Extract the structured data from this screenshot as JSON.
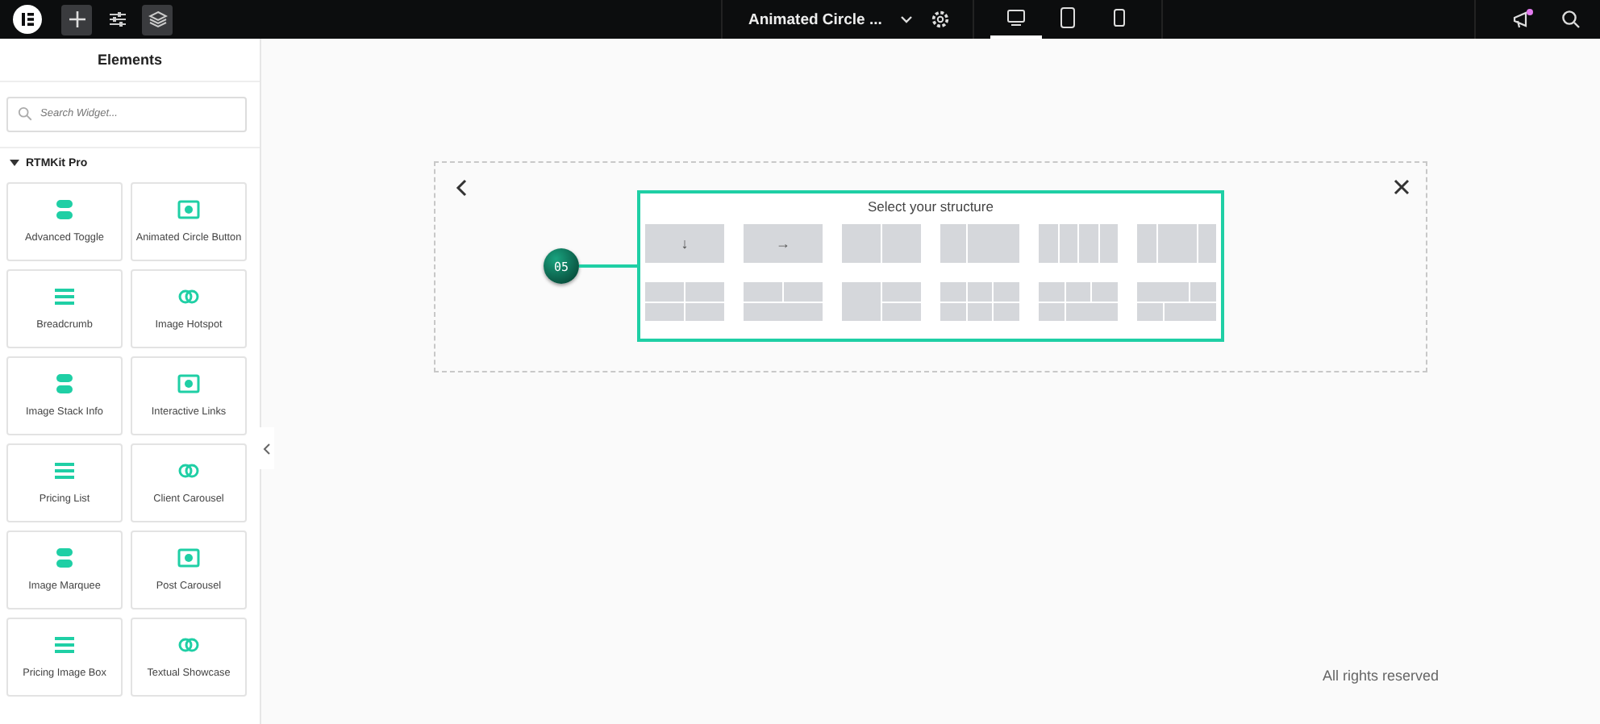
{
  "topbar": {
    "document_title": "Animated Circle ...",
    "devices": [
      {
        "selected": true
      },
      {
        "selected": false
      },
      {
        "selected": false
      }
    ],
    "notification": true
  },
  "sidebar": {
    "title": "Elements",
    "search": {
      "placeholder": "Search Widget..."
    },
    "category": {
      "label": "RTMKit Pro",
      "expanded": true
    },
    "widgets": [
      {
        "label": "Advanced Toggle"
      },
      {
        "label": "Animated Circle Button"
      },
      {
        "label": "Breadcrumb"
      },
      {
        "label": "Image Hotspot"
      },
      {
        "label": "Image Stack Info"
      },
      {
        "label": "Interactive Links"
      },
      {
        "label": "Pricing List"
      },
      {
        "label": "Client Carousel"
      },
      {
        "label": "Image Marquee"
      },
      {
        "label": "Post Carousel"
      },
      {
        "label": "Pricing Image Box"
      },
      {
        "label": "Textual Showcase"
      }
    ]
  },
  "canvas": {
    "step_badge": "05",
    "structure_picker": {
      "title": "Select your structure",
      "structures": [
        {
          "kind": "single",
          "glyph": "↓"
        },
        {
          "kind": "single",
          "glyph": "→"
        },
        {
          "kind": "halves"
        },
        {
          "kind": "third-twothirds"
        },
        {
          "kind": "quarters"
        },
        {
          "kind": "quarter-half-quarter"
        },
        {
          "kind": "grid-2x2"
        },
        {
          "kind": "two-over-one"
        },
        {
          "kind": "one-beside-two"
        },
        {
          "kind": "grid-3x2"
        },
        {
          "kind": "three-over-two"
        },
        {
          "kind": "mixed-two-rows"
        }
      ]
    },
    "footer": "All rights reserved"
  }
}
